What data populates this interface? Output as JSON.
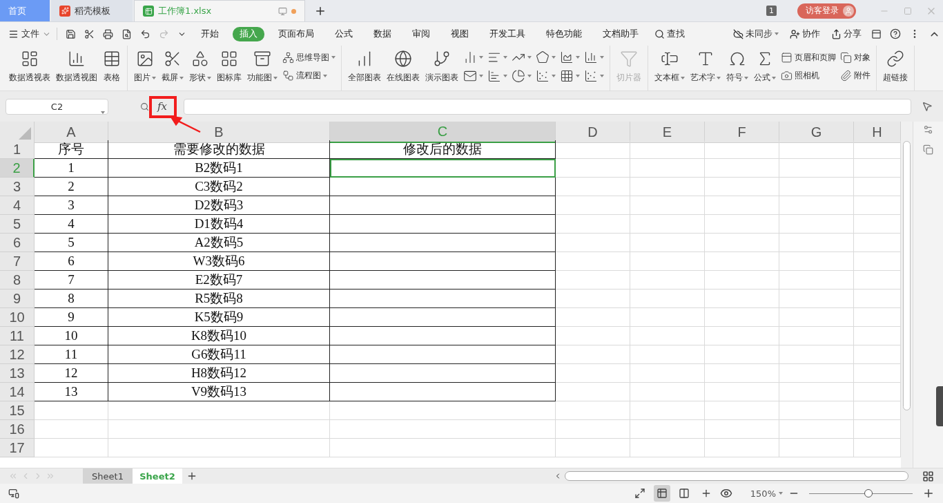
{
  "tabs": [
    {
      "kind": "home",
      "label": "首页",
      "selected": false
    },
    {
      "kind": "template",
      "label": "稻壳模板",
      "selected": false
    },
    {
      "kind": "document",
      "label": "工作簿1.xlsx",
      "selected": true,
      "unsaved": true
    }
  ],
  "window_controls": {
    "badge": "1",
    "login": "访客登录"
  },
  "menu": {
    "file": "文件",
    "ribbon_tabs": [
      {
        "label": "开始",
        "selected": false
      },
      {
        "label": "插入",
        "selected": true
      },
      {
        "label": "页面布局",
        "selected": false
      },
      {
        "label": "公式",
        "selected": false
      },
      {
        "label": "数据",
        "selected": false
      },
      {
        "label": "审阅",
        "selected": false
      },
      {
        "label": "视图",
        "selected": false
      },
      {
        "label": "开发工具",
        "selected": false
      },
      {
        "label": "特色功能",
        "selected": false
      },
      {
        "label": "文档助手",
        "selected": false
      }
    ],
    "search": "查找",
    "actions": [
      "未同步",
      "协作",
      "分享"
    ]
  },
  "ribbon": [
    [
      {
        "kind": "large",
        "label": "数据透视表",
        "dropdown": false
      },
      {
        "kind": "large",
        "label": "数据透视图",
        "dropdown": false
      },
      {
        "kind": "large",
        "label": "表格",
        "dropdown": false
      }
    ],
    [
      {
        "kind": "large",
        "label": "图片",
        "dropdown": true
      },
      {
        "kind": "large",
        "label": "截屏",
        "dropdown": true
      },
      {
        "kind": "large",
        "label": "形状",
        "dropdown": true
      },
      {
        "kind": "large",
        "label": "图标库",
        "dropdown": false
      },
      {
        "kind": "large",
        "label": "功能图",
        "dropdown": true
      },
      {
        "kind": "stack",
        "items": [
          {
            "label": "思维导图",
            "dropdown": true
          },
          {
            "label": "流程图",
            "dropdown": true
          }
        ]
      }
    ],
    [
      {
        "kind": "large",
        "label": "全部图表",
        "dropdown": false
      },
      {
        "kind": "large",
        "label": "在线图表",
        "dropdown": false
      },
      {
        "kind": "large",
        "label": "演示图表",
        "dropdown": false
      },
      {
        "kind": "stack",
        "items": [
          {
            "dropdown": true
          },
          {
            "dropdown": true
          }
        ]
      },
      {
        "kind": "stack",
        "items": [
          {
            "dropdown": true
          },
          {
            "dropdown": true
          }
        ]
      },
      {
        "kind": "stack",
        "items": [
          {
            "dropdown": true
          },
          {
            "dropdown": true
          }
        ]
      },
      {
        "kind": "stack",
        "items": [
          {
            "dropdown": true
          },
          {
            "dropdown": true
          }
        ]
      },
      {
        "kind": "stack",
        "items": [
          {
            "dropdown": true
          },
          {
            "dropdown": true
          }
        ]
      },
      {
        "kind": "stack",
        "items": [
          {
            "dropdown": true
          },
          {
            "dropdown": true
          }
        ]
      }
    ],
    [
      {
        "kind": "large",
        "label": "切片器",
        "dropdown": false,
        "disabled": true
      }
    ],
    [
      {
        "kind": "large",
        "label": "文本框",
        "dropdown": true
      },
      {
        "kind": "large",
        "label": "艺术字",
        "dropdown": true
      },
      {
        "kind": "large",
        "label": "符号",
        "dropdown": true
      },
      {
        "kind": "large",
        "label": "公式",
        "dropdown": true
      },
      {
        "kind": "stack",
        "items": [
          {
            "label": "页眉和页脚",
            "dropdown": false
          },
          {
            "label": "照相机",
            "dropdown": false
          }
        ]
      },
      {
        "kind": "stack",
        "items": [
          {
            "label": "对象",
            "dropdown": false
          },
          {
            "label": "附件",
            "dropdown": false
          }
        ]
      }
    ],
    [
      {
        "kind": "large",
        "label": "超链接",
        "dropdown": false
      }
    ]
  ],
  "formula_bar": {
    "name_box": "C2",
    "function_label": "fx"
  },
  "sheet": {
    "columns": [
      {
        "label": "A",
        "selected": false
      },
      {
        "label": "B",
        "selected": false
      },
      {
        "label": "C",
        "selected": true
      },
      {
        "label": "D",
        "selected": false
      },
      {
        "label": "E",
        "selected": false
      },
      {
        "label": "F",
        "selected": false
      },
      {
        "label": "G",
        "selected": false
      },
      {
        "label": "H",
        "selected": false
      }
    ],
    "rows": [
      {
        "number": "1",
        "selected": false,
        "cells": [
          "序号",
          "需要修改的数据",
          "修改后的数据"
        ]
      },
      {
        "number": "2",
        "selected": true,
        "cells": [
          "1",
          "B2数码1"
        ]
      },
      {
        "number": "3",
        "selected": false,
        "cells": [
          "2",
          "C3数码2"
        ]
      },
      {
        "number": "4",
        "selected": false,
        "cells": [
          "3",
          "D2数码3"
        ]
      },
      {
        "number": "5",
        "selected": false,
        "cells": [
          "4",
          "D1数码4"
        ]
      },
      {
        "number": "6",
        "selected": false,
        "cells": [
          "5",
          "A2数码5"
        ]
      },
      {
        "number": "7",
        "selected": false,
        "cells": [
          "6",
          "W3数码6"
        ]
      },
      {
        "number": "8",
        "selected": false,
        "cells": [
          "7",
          "E2数码7"
        ]
      },
      {
        "number": "9",
        "selected": false,
        "cells": [
          "8",
          "R5数码8"
        ]
      },
      {
        "number": "10",
        "selected": false,
        "cells": [
          "9",
          "K5数码9"
        ]
      },
      {
        "number": "11",
        "selected": false,
        "cells": [
          "10",
          "K8数码10"
        ]
      },
      {
        "number": "12",
        "selected": false,
        "cells": [
          "11",
          "G6数码11"
        ]
      },
      {
        "number": "13",
        "selected": false,
        "cells": [
          "12",
          "H8数码12"
        ]
      },
      {
        "number": "14",
        "selected": false,
        "cells": [
          "13",
          "V9数码13"
        ]
      },
      {
        "number": "15",
        "selected": false
      },
      {
        "number": "16",
        "selected": false
      },
      {
        "number": "17",
        "selected": false
      }
    ]
  },
  "sheet_tabs": [
    {
      "label": "Sheet1",
      "selected": false
    },
    {
      "label": "Sheet2",
      "selected": true
    }
  ],
  "status_bar": {
    "view_modes": [
      {
        "selected": false
      },
      {
        "selected": true
      },
      {
        "selected": false
      },
      {
        "selected": false
      }
    ],
    "zoom": "150%",
    "zoom_slider": {
      "level": 0.57
    }
  }
}
